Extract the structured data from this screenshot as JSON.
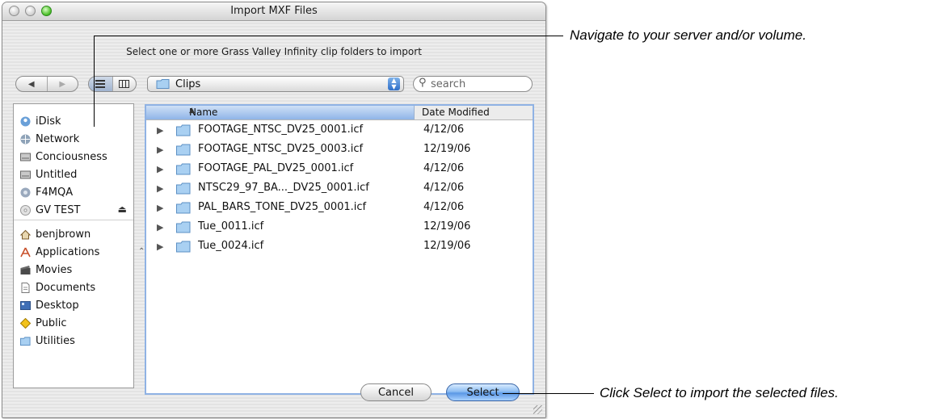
{
  "window": {
    "title": "Import MXF Files",
    "prompt": "Select one or more Grass Valley Infinity clip folders to import"
  },
  "toolbar": {
    "back_glyph": "◀",
    "forward_glyph": "▶",
    "location": "Clips",
    "search_placeholder": "search"
  },
  "sidebar": {
    "devices": [
      {
        "label": "iDisk",
        "icon": "idisk-icon"
      },
      {
        "label": "Network",
        "icon": "network-icon"
      },
      {
        "label": "Conciousness",
        "icon": "hard-drive-icon"
      },
      {
        "label": "Untitled",
        "icon": "hard-drive-icon"
      },
      {
        "label": "F4MQA",
        "icon": "network-volume-icon"
      },
      {
        "label": "GV TEST",
        "icon": "disc-icon"
      }
    ],
    "places": [
      {
        "label": "benjbrown",
        "icon": "home-icon"
      },
      {
        "label": "Applications",
        "icon": "applications-icon"
      },
      {
        "label": "Movies",
        "icon": "movies-icon"
      },
      {
        "label": "Documents",
        "icon": "documents-icon"
      },
      {
        "label": "Desktop",
        "icon": "desktop-icon"
      },
      {
        "label": "Public",
        "icon": "public-icon"
      },
      {
        "label": "Utilities",
        "icon": "folder-icon"
      }
    ]
  },
  "file_list": {
    "columns": {
      "name": "Name",
      "date": "Date Modified"
    },
    "rows": [
      {
        "name": "FOOTAGE_NTSC_DV25_0001.icf",
        "date": "4/12/06"
      },
      {
        "name": "FOOTAGE_NTSC_DV25_0003.icf",
        "date": "12/19/06"
      },
      {
        "name": "FOOTAGE_PAL_DV25_0001.icf",
        "date": "4/12/06"
      },
      {
        "name": "NTSC29_97_BA..._DV25_0001.icf",
        "date": "4/12/06"
      },
      {
        "name": "PAL_BARS_TONE_DV25_0001.icf",
        "date": "4/12/06"
      },
      {
        "name": "Tue_0011.icf",
        "date": "12/19/06"
      },
      {
        "name": "Tue_0024.icf",
        "date": "12/19/06"
      }
    ]
  },
  "buttons": {
    "cancel": "Cancel",
    "select": "Select"
  },
  "callouts": {
    "navigate": "Navigate to your server and/or volume.",
    "select": "Click Select to import the selected files."
  },
  "colors": {
    "accent": "#5b98e6",
    "selection_border": "#8fb2e4"
  }
}
